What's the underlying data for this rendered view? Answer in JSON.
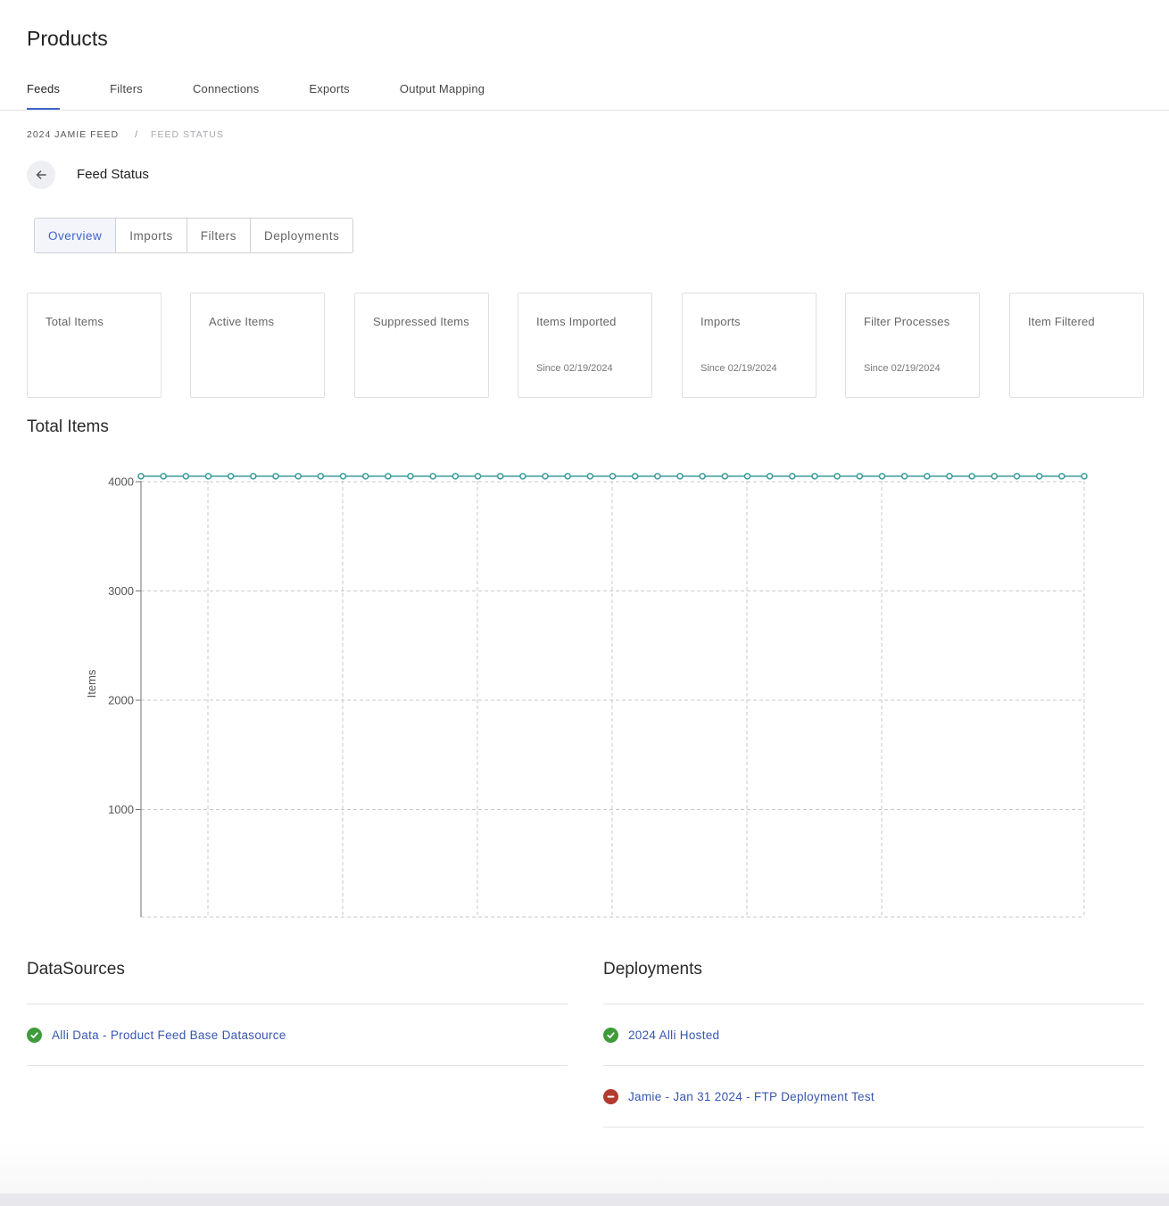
{
  "header": {
    "title": "Products"
  },
  "top_tabs": [
    {
      "label": "Feeds",
      "active": true
    },
    {
      "label": "Filters",
      "active": false
    },
    {
      "label": "Connections",
      "active": false
    },
    {
      "label": "Exports",
      "active": false
    },
    {
      "label": "Output Mapping",
      "active": false
    }
  ],
  "breadcrumb": {
    "parent": "2024 JAMIE FEED",
    "separator": "/",
    "current": "FEED STATUS"
  },
  "page": {
    "subtitle": "Feed Status",
    "back_icon": "arrow-left-icon"
  },
  "sub_tabs": [
    {
      "label": "Overview",
      "active": true
    },
    {
      "label": "Imports",
      "active": false
    },
    {
      "label": "Filters",
      "active": false
    },
    {
      "label": "Deployments",
      "active": false
    }
  ],
  "stats": [
    {
      "label": "Total Items",
      "sub": ""
    },
    {
      "label": "Active Items",
      "sub": ""
    },
    {
      "label": "Suppressed Items",
      "sub": ""
    },
    {
      "label": "Items Imported",
      "sub": "Since 02/19/2024"
    },
    {
      "label": "Imports",
      "sub": "Since 02/19/2024"
    },
    {
      "label": "Filter Processes",
      "sub": "Since 02/19/2024"
    },
    {
      "label": "Item Filtered",
      "sub": ""
    }
  ],
  "chart_section": {
    "title": "Total Items"
  },
  "chart_data": {
    "type": "line",
    "ylabel": "Items",
    "xlabel": "",
    "ylim": [
      0,
      4000
    ],
    "yticks": [
      1000,
      2000,
      3000,
      4000
    ],
    "grid": true,
    "color": "#3a9a9a",
    "values": [
      4050,
      4050,
      4050,
      4050,
      4050,
      4050,
      4050,
      4050,
      4050,
      4050,
      4050,
      4050,
      4050,
      4050,
      4050,
      4050,
      4050,
      4050,
      4050,
      4050,
      4050,
      4050,
      4050,
      4050,
      4050,
      4050,
      4050,
      4050,
      4050,
      4050,
      4050,
      4050,
      4050,
      4050,
      4050,
      4050,
      4050,
      4050,
      4050,
      4050,
      4050,
      4050,
      4050
    ]
  },
  "datasources": {
    "title": "DataSources",
    "items": [
      {
        "label": "Alli Data - Product Feed Base Datasource",
        "status": "ok",
        "icon": "check-icon"
      }
    ]
  },
  "deployments": {
    "title": "Deployments",
    "items": [
      {
        "label": "2024 Alli Hosted",
        "status": "ok",
        "icon": "check-icon"
      },
      {
        "label": "Jamie - Jan 31 2024 - FTP Deployment Test",
        "status": "error",
        "icon": "minus-icon"
      }
    ]
  },
  "colors": {
    "accent": "#3f63c9",
    "link": "#3856b0",
    "success": "#3f9b3a",
    "error": "#b23a2e",
    "series": "#3a9a9a"
  }
}
